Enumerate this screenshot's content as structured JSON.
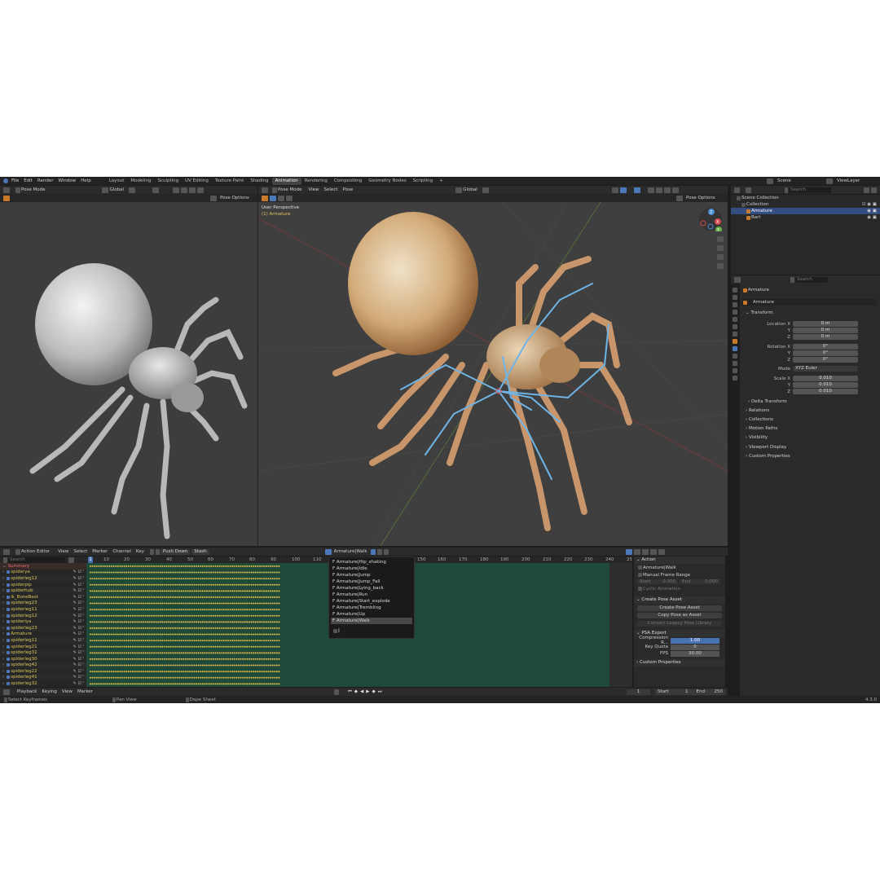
{
  "top_menu": [
    "File",
    "Edit",
    "Render",
    "Window",
    "Help"
  ],
  "workspace_tabs": [
    {
      "label": "Layout",
      "active": false
    },
    {
      "label": "Modeling",
      "active": false
    },
    {
      "label": "Sculpting",
      "active": false
    },
    {
      "label": "UV Editing",
      "active": false
    },
    {
      "label": "Texture Paint",
      "active": false
    },
    {
      "label": "Shading",
      "active": false
    },
    {
      "label": "Animation",
      "active": true
    },
    {
      "label": "Rendering",
      "active": false
    },
    {
      "label": "Compositing",
      "active": false
    },
    {
      "label": "Geometry Nodes",
      "active": false
    },
    {
      "label": "Scripting",
      "active": false
    }
  ],
  "add_tab": "+",
  "scene": {
    "label": "Scene",
    "view_layer": "ViewLayer"
  },
  "left_viewport": {
    "mode": "Pose Mode",
    "orientation": "Global",
    "pose_options": "Pose Options"
  },
  "main_viewport": {
    "mode": "Pose Mode",
    "menu": [
      "View",
      "Select",
      "Pose"
    ],
    "orientation": "Global",
    "pose_options": "Pose Options",
    "overlay_title": "User Perspective",
    "overlay_object": "(1) Armature",
    "gizmo_axes": [
      "X",
      "Y",
      "Z"
    ]
  },
  "outliner": {
    "search_placeholder": "Search",
    "items": [
      {
        "label": "Scene Collection",
        "indent": 0,
        "selected": false
      },
      {
        "label": "Collection",
        "indent": 1,
        "selected": false
      },
      {
        "label": "Armature",
        "indent": 2,
        "selected": true
      },
      {
        "label": "Bart",
        "indent": 2,
        "selected": false
      }
    ]
  },
  "properties": {
    "search_placeholder": "Search",
    "breadcrumb": "Armature",
    "object_name": "Armature",
    "transform_label": "Transform",
    "location": {
      "label": "Location X",
      "x": "0 m",
      "y": "0 m",
      "z": "0 m"
    },
    "rotation": {
      "label": "Rotation X",
      "x": "0°",
      "y": "0°",
      "z": "0°"
    },
    "mode": {
      "label": "Mode",
      "value": "XYZ Euler"
    },
    "scale": {
      "label": "Scale X",
      "x": "0.010",
      "y": "0.010",
      "z": "0.010"
    },
    "axis_y": "Y",
    "axis_z": "Z",
    "sections": [
      "Delta Transform",
      "Relations",
      "Collections",
      "Motion Paths",
      "Visibility",
      "Viewport Display",
      "Custom Properties"
    ]
  },
  "action_editor": {
    "mode": "Action Editor",
    "menu": [
      "View",
      "Select",
      "Marker",
      "Channel",
      "Key"
    ],
    "push_down": "Push Down",
    "stash": "Stash",
    "action_name": "Armature|Walk",
    "search_placeholder": "Search",
    "current_frame_marker": "1",
    "ruler": [
      "1",
      "10",
      "20",
      "30",
      "40",
      "50",
      "60",
      "70",
      "80",
      "90",
      "100",
      "110",
      "150",
      "160",
      "170",
      "180",
      "190",
      "200",
      "210",
      "220",
      "230",
      "240",
      "250"
    ],
    "summary": "Summary",
    "channels": [
      "spiderya",
      "spiderleg12",
      "spiderpip",
      "spiderhub",
      "ik_BoneBest",
      "spiderleg23",
      "spiderleg11",
      "spiderleg12",
      "spideriya",
      "spiderleg23",
      "Armature",
      "spiderleg11",
      "spiderleg21",
      "spiderleg31",
      "spiderleg30",
      "spiderleg42",
      "spiderleg22",
      "spiderleg41",
      "spiderleg32"
    ]
  },
  "action_dropdown": {
    "items": [
      "Armature|Hip_shaking",
      "Armature|Idle",
      "Armature|Jump",
      "Armature|Jump_Fall",
      "Armature|Lying_back",
      "Armature|Run",
      "Armature|Start_explode",
      "Armature|Trembling",
      "Armature|Up",
      "Armature|Walk"
    ],
    "highlighted": "Armature|Walk",
    "prefix": "F"
  },
  "right_panel": {
    "action_header": "Action",
    "action_name": "Armature|Walk",
    "manual_frame_range": "Manual Frame Range",
    "start_label": "Start",
    "start_value": "0.000",
    "end_label": "End",
    "end_value": "0.000",
    "cyclic": "Cyclic Animation",
    "create_pose_asset_header": "Create Pose Asset",
    "create_pose_asset": "Create Pose Asset",
    "copy_pose_as_asset": "Copy Pose as Asset",
    "convert_legacy": "Convert Legacy Pose Library",
    "psa_export": "PSA Export",
    "compression_label": "Compression R...",
    "compression_value": "1.00",
    "key_quota_label": "Key Quota",
    "key_quota_value": "0",
    "fps_label": "FPS",
    "fps_value": "30.00",
    "custom_properties": "Custom Properties"
  },
  "timeline": {
    "menu": [
      "Playback",
      "Keying",
      "View",
      "Marker"
    ],
    "current_frame": "1",
    "start_label": "Start",
    "start": "1",
    "end_label": "End",
    "end": "250"
  },
  "status_bar": {
    "left": "Select Keyframes",
    "middle": "Pan View",
    "right": "Dope Sheet",
    "version": "4.3.0"
  },
  "colors": {
    "accent": "#4772b3",
    "active_tab": "#444444",
    "keyframe": "#e0b84a",
    "dope_green": "#1f4a3a",
    "channel_text": "#d9c45a",
    "bone": "#6fb4e6",
    "spider_body": "#d6b48a"
  }
}
